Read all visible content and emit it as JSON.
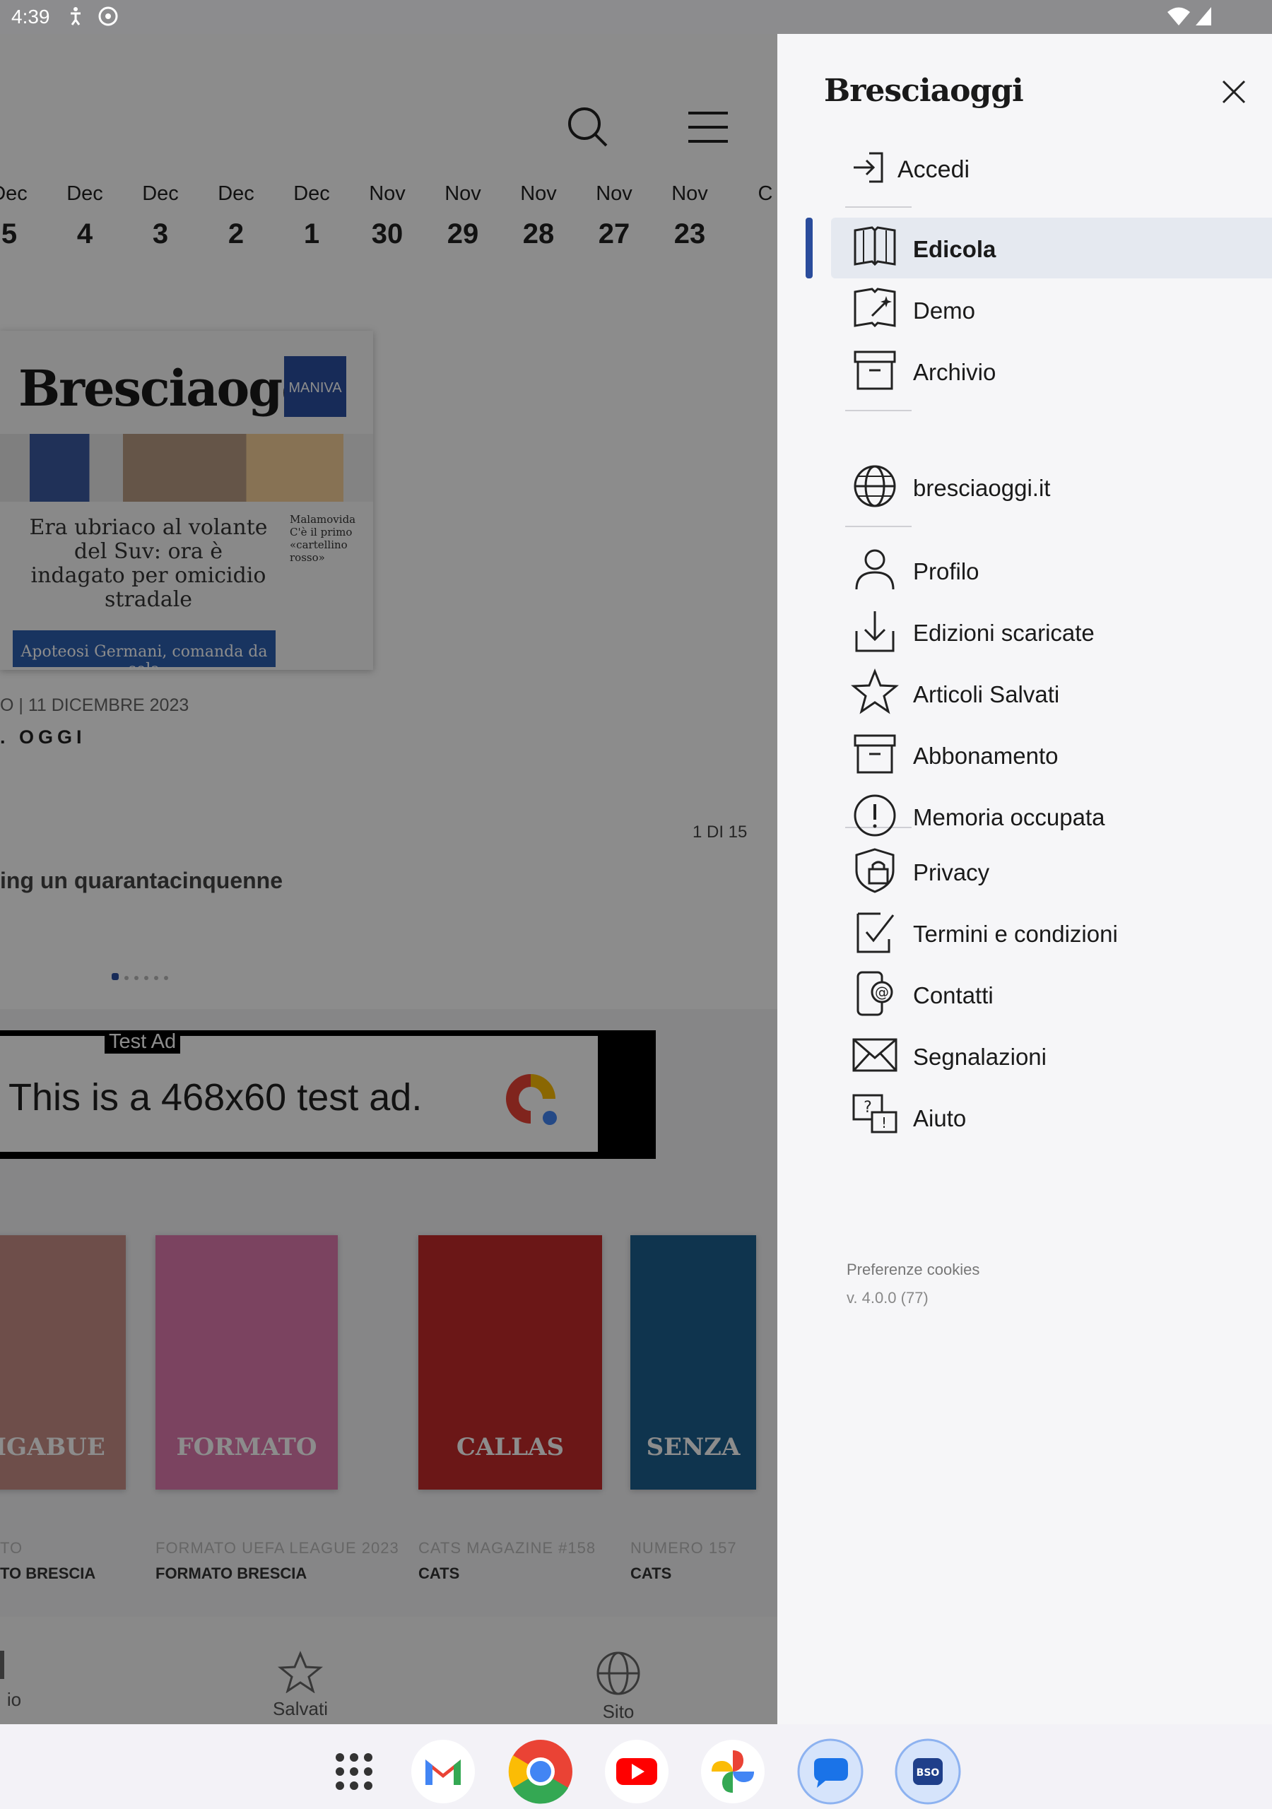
{
  "status_bar": {
    "time": "4:39"
  },
  "background": {
    "dates": [
      {
        "month": "Dec",
        "day": "5"
      },
      {
        "month": "Dec",
        "day": "4"
      },
      {
        "month": "Dec",
        "day": "3"
      },
      {
        "month": "Dec",
        "day": "2"
      },
      {
        "month": "Dec",
        "day": "1"
      },
      {
        "month": "Nov",
        "day": "30"
      },
      {
        "month": "Nov",
        "day": "29"
      },
      {
        "month": "Nov",
        "day": "28"
      },
      {
        "month": "Nov",
        "day": "27"
      },
      {
        "month": "Nov",
        "day": "23"
      },
      {
        "month": "C",
        "day": ""
      }
    ],
    "cover": {
      "masthead": "Bresciaoggi",
      "badge": "MANIVA",
      "headline": "Era ubriaco al volante del Suv: ora è indagato per omicidio stradale",
      "side_text": "Malamovida C'è il primo «cartellino rosso»",
      "bottom_strip": "Apoteosi Germani, comanda da sola"
    },
    "issue_date": "O | 11 DICEMBRE 2023",
    "issue_name": ". OGGI",
    "page_counter": "1 DI 15",
    "snippet": "ing un quarantacinquenne",
    "ad": {
      "label": "Test Ad",
      "message": "This is a 468x60 test ad."
    },
    "magazines": [
      {
        "title": "TO",
        "publisher": "TO BRESCIA",
        "cover_text": "LIGABUE",
        "cover_color": "#c98f88"
      },
      {
        "title": "FORMATO UEFA LEAGUE 2023",
        "publisher": "FORMATO BRESCIA",
        "cover_text": "FORMATO",
        "cover_color": "#e07ab0"
      },
      {
        "title": "CATS MAGAZINE #158",
        "publisher": "CATS",
        "cover_text": "CALLAS",
        "cover_color": "#c42a2a"
      },
      {
        "title": "NUMERO 157",
        "publisher": "CATS",
        "cover_text": "SENZA",
        "cover_color": "#1c5f8e"
      }
    ],
    "bottom_nav": [
      {
        "label": "io"
      },
      {
        "label": "Salvati"
      },
      {
        "label": "Sito"
      }
    ]
  },
  "drawer": {
    "brand": "Bresciaoggi",
    "login_label": "Accedi",
    "items_group1": [
      {
        "label": "Edicola",
        "icon": "book-icon",
        "active": true
      },
      {
        "label": "Demo",
        "icon": "magic-book-icon"
      },
      {
        "label": "Archivio",
        "icon": "archive-icon"
      }
    ],
    "items_group2": [
      {
        "label": "bresciaoggi.it",
        "icon": "globe-icon"
      }
    ],
    "items_group3": [
      {
        "label": "Profilo",
        "icon": "user-icon"
      },
      {
        "label": "Edizioni scaricate",
        "icon": "download-icon"
      },
      {
        "label": "Articoli Salvati",
        "icon": "star-icon"
      },
      {
        "label": "Abbonamento",
        "icon": "archive-icon"
      },
      {
        "label": "Memoria occupata",
        "icon": "alert-circle-icon"
      }
    ],
    "items_group4": [
      {
        "label": "Privacy",
        "icon": "shield-lock-icon"
      },
      {
        "label": "Termini e condizioni",
        "icon": "document-check-icon"
      },
      {
        "label": "Contatti",
        "icon": "phone-at-icon"
      },
      {
        "label": "Segnalazioni",
        "icon": "envelope-icon"
      },
      {
        "label": "Aiuto",
        "icon": "help-chat-icon"
      }
    ],
    "cookies_label": "Preferenze cookies",
    "version": "v. 4.0.0 (77)"
  },
  "dock": [
    {
      "name": "app-drawer-icon"
    },
    {
      "name": "gmail-icon"
    },
    {
      "name": "chrome-icon"
    },
    {
      "name": "youtube-icon"
    },
    {
      "name": "photos-icon"
    },
    {
      "name": "messages-icon"
    },
    {
      "name": "bso-app-icon"
    }
  ],
  "colors": {
    "accent": "#2a4c9c",
    "active_bg": "#e5e9f0",
    "scrim": "rgba(0,0,0,0.45)"
  }
}
